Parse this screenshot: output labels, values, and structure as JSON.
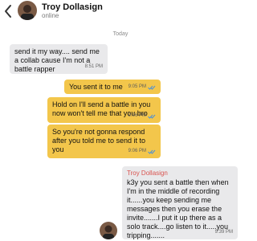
{
  "header": {
    "name": "Troy Dollasign",
    "status": "online"
  },
  "chat": {
    "day_label": "Today",
    "messages": [
      {
        "direction": "in",
        "text": "send it my way.... send me a collab cause I'm not a battle rapper",
        "time": "8:51 PM"
      },
      {
        "direction": "out",
        "text": "You sent it to me",
        "time": "9:05 PM"
      },
      {
        "direction": "out",
        "text": "Hold on I'll send a battle in you now won't tell me that you bro",
        "time": "9:06 PM"
      },
      {
        "direction": "out",
        "text": "So you're not gonna respond after you told me to send it to you",
        "time": "9:06 PM"
      },
      {
        "direction": "in",
        "sender": "Troy Dollasign",
        "text": "k3y you sent a battle then when I'm in the middle of recording it......you keep sending me messages then you erase the invite.......I put it up there as a solo track....go listen to it.....you tripping.......",
        "time": "9:39 PM"
      }
    ]
  },
  "colors": {
    "incoming_bubble": "#e9e9eb",
    "outgoing_bubble": "#f3c64b",
    "read_check": "#4a90d9",
    "sender_name": "#d9534f"
  },
  "icons": {
    "back": "chevron-left-icon",
    "read": "double-check-icon"
  }
}
